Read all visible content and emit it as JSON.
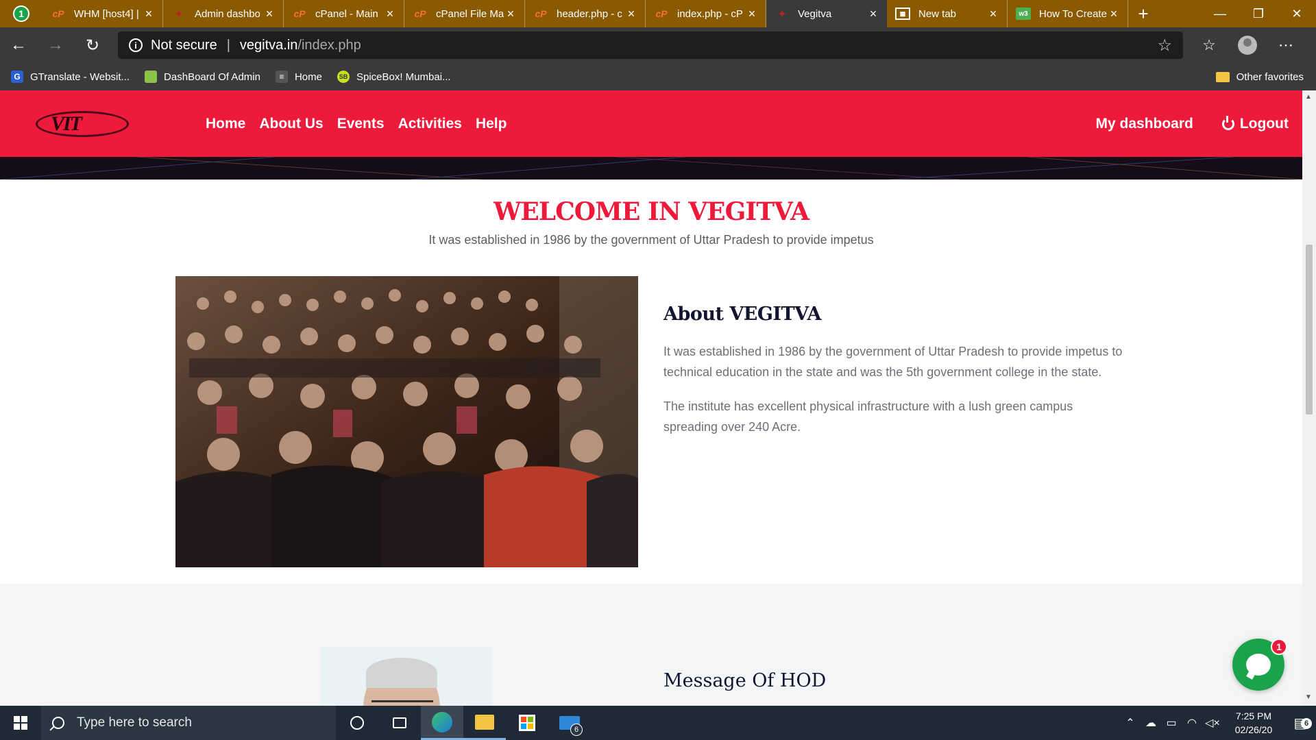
{
  "browser": {
    "profile_badge": "1",
    "tabs": [
      {
        "title": "WHM [host4] |",
        "icon": "cpanel-icon"
      },
      {
        "title": "Admin dashbo",
        "icon": "site-favicon"
      },
      {
        "title": "cPanel - Main",
        "icon": "cpanel-icon"
      },
      {
        "title": "cPanel File Ma",
        "icon": "cpanel-icon"
      },
      {
        "title": "header.php - c",
        "icon": "cpanel-icon"
      },
      {
        "title": "index.php - cP",
        "icon": "cpanel-icon"
      },
      {
        "title": "Vegitva",
        "icon": "site-favicon",
        "active": true
      },
      {
        "title": "New tab",
        "icon": "newtab-icon"
      },
      {
        "title": "How To Create",
        "icon": "w3-icon"
      }
    ],
    "address": {
      "security": "Not secure",
      "host": "vegitva.in",
      "path": "/index.php"
    },
    "bookmarks": [
      {
        "label": "GTranslate - Websit..."
      },
      {
        "label": "DashBoard Of Admin"
      },
      {
        "label": "Home"
      },
      {
        "label": "SpiceBox! Mumbai..."
      }
    ],
    "other_favorites": "Other favorites"
  },
  "site": {
    "logo_text": "VIT",
    "nav": [
      "Home",
      "About Us",
      "Events",
      "Activities",
      "Help"
    ],
    "dashboard": "My dashboard",
    "logout": "Logout",
    "accent": "#ee1a3b",
    "welcome": {
      "title": "WELCOME IN VEGITVA",
      "subtitle": "It was established in 1986 by the government of Uttar Pradesh to provide impetus"
    },
    "about": {
      "heading": "About VEGITVA",
      "para1": "It was established in 1986 by the government of Uttar Pradesh to provide impetus to technical education in the state and was the 5th government college in the state.",
      "para2": "The institute has excellent physical infrastructure with a lush green campus spreading over 240 Acre."
    },
    "hod_heading": "Message Of HOD",
    "chat_badge": "1"
  },
  "taskbar": {
    "search_placeholder": "Type here to search",
    "mail_badge": "6",
    "time": "7:25 PM",
    "date": "02/26/20",
    "notifications": "6"
  }
}
